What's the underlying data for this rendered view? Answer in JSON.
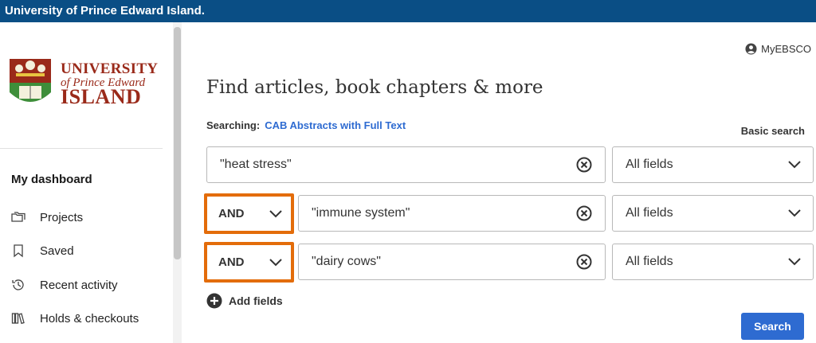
{
  "topbar": {
    "title": "University of Prince Edward Island."
  },
  "logo": {
    "line1": "UNIVERSITY",
    "line2": "of Prince Edward",
    "line3": "ISLAND"
  },
  "sidebar": {
    "heading": "My dashboard",
    "items": [
      {
        "label": "Projects",
        "icon": "folder-icon"
      },
      {
        "label": "Saved",
        "icon": "bookmark-icon"
      },
      {
        "label": "Recent activity",
        "icon": "history-icon"
      },
      {
        "label": "Holds & checkouts",
        "icon": "books-icon"
      }
    ]
  },
  "header": {
    "myebsco": "MyEBSCO"
  },
  "main": {
    "title": "Find articles, book chapters & more",
    "searching_label": "Searching:",
    "database": "CAB Abstracts with Full Text",
    "basic_search": "Basic search",
    "rows": [
      {
        "operator": null,
        "term": "\"heat stress\"",
        "field": "All fields"
      },
      {
        "operator": "AND",
        "term": "\"immune system\"",
        "field": "All fields"
      },
      {
        "operator": "AND",
        "term": "\"dairy cows\"",
        "field": "All fields"
      }
    ],
    "add_fields": "Add fields",
    "search_button": "Search"
  },
  "colors": {
    "topbar": "#0a4e85",
    "accent_link": "#2e6bd1",
    "highlight": "#e36c0a",
    "logo_red": "#9a2a1a"
  }
}
